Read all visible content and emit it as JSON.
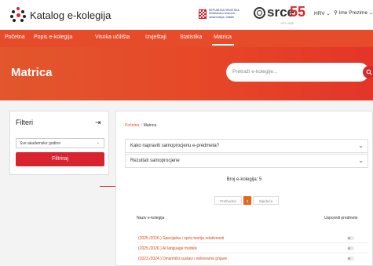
{
  "header": {
    "app_title": "Katalog e-kolegija",
    "ministry_lines": [
      "REPUBLIKA HRVATSKA",
      "Ministarstvo znanosti,",
      "obrazovanja i mladih"
    ],
    "srce_word": "srce",
    "srce_number": "55",
    "srce_subtitle": "1971-2026",
    "language": "HRV",
    "user": "Ime Prezime"
  },
  "nav": {
    "items": [
      "Početna",
      "Popis e-kolegija",
      "Visoka učilišta",
      "Izvještaji",
      "Statistika",
      "Matrica"
    ],
    "active": "Matrica"
  },
  "hero": {
    "title": "Matrica",
    "search_placeholder": "Pretraži e-kolegije..."
  },
  "filters": {
    "title": "Filteri",
    "select_value": "Sve akademske godine",
    "button_label": "Filtriraj"
  },
  "breadcrumb": {
    "home": "Početna",
    "separator": "/",
    "current": "Matrica"
  },
  "accordions": [
    "Kako napraviti samoprocjenu e-predmeta?",
    "Rezultati samoprocjene"
  ],
  "results": {
    "count_text": "Broj e-kolegija: 5",
    "pager": {
      "prev": "Prethodna",
      "page": "1",
      "next": "Sljedeća"
    },
    "columns": [
      "Naziv e-kolegija",
      "Usporedi predmete"
    ],
    "rows": [
      "(2025./2026.) Specijalna i opća teorija relativnosti",
      "(2025./2026.) AI language models",
      "(2023./2024.) Dinamički sustavi i nelinearne pojave"
    ]
  },
  "colors": {
    "accent": "#e64b2a",
    "button": "#d9232e",
    "link": "#d8471a"
  }
}
